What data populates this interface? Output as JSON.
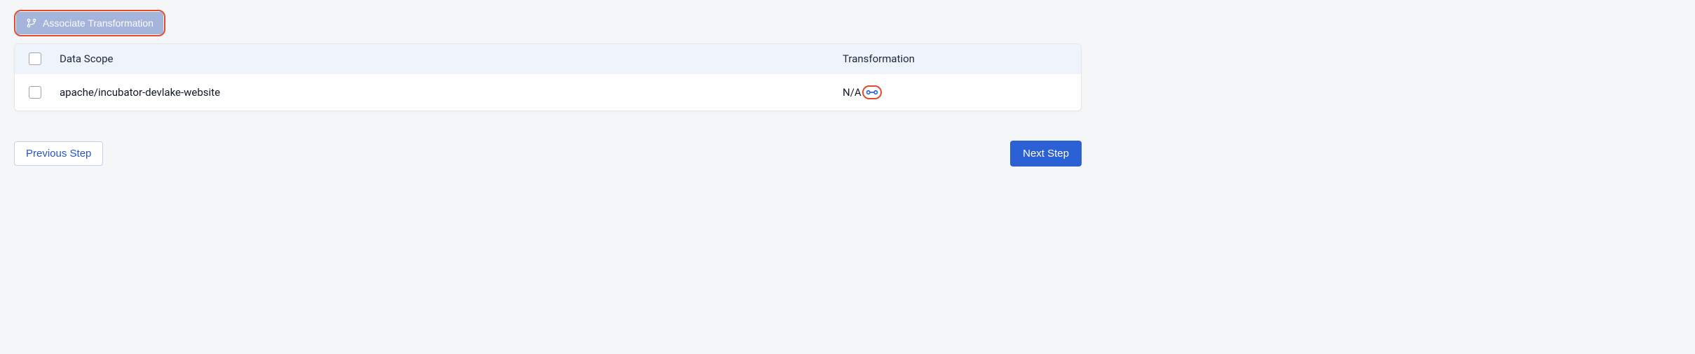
{
  "toolbar": {
    "associate_label": "Associate Transformation"
  },
  "table": {
    "headers": {
      "scope": "Data Scope",
      "transformation": "Transformation"
    },
    "rows": [
      {
        "scope": "apache/incubator-devlake-website",
        "transformation": "N/A"
      }
    ]
  },
  "footer": {
    "previous": "Previous Step",
    "next": "Next Step"
  }
}
